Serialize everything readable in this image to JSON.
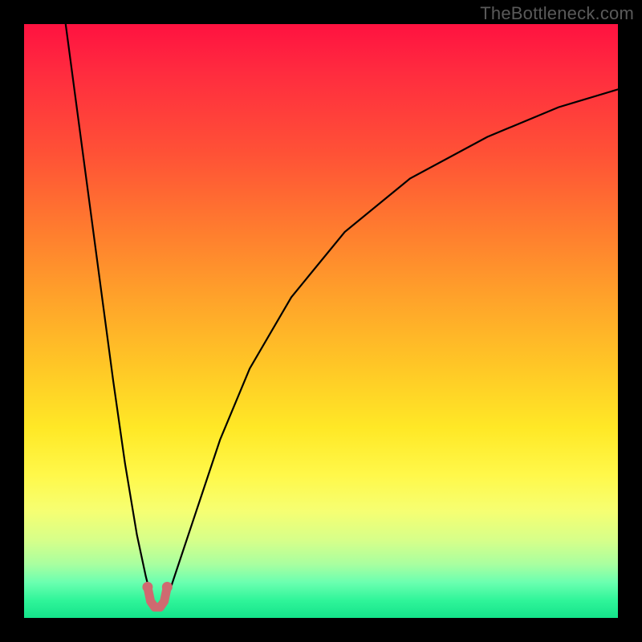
{
  "watermark": "TheBottleneck.com",
  "colors": {
    "frame": "#000000",
    "curve_stroke": "#000000",
    "marker_stroke": "#b95a60",
    "marker_fill": "#d97a80",
    "gradient_top": "#ff1240",
    "gradient_bottom": "#14e38a"
  },
  "chart_data": {
    "type": "line",
    "title": "",
    "xlabel": "",
    "ylabel": "",
    "xlim": [
      0,
      100
    ],
    "ylim": [
      0,
      100
    ],
    "grid": false,
    "notes": "Two thin black curves forming a V/funnel shape; both meet near x≈22 at the bottom. A short salmon U-shaped marker segment sits at the valley. Background is a vertical rainbow gradient (red→green).",
    "series": [
      {
        "name": "left_curve",
        "x": [
          7,
          9,
          11,
          13,
          15,
          17,
          19,
          20.5,
          21.5
        ],
        "y": [
          100,
          85,
          70,
          55,
          40,
          26,
          14,
          7,
          3
        ]
      },
      {
        "name": "right_curve",
        "x": [
          24,
          26,
          29,
          33,
          38,
          45,
          54,
          65,
          78,
          90,
          100
        ],
        "y": [
          3,
          9,
          18,
          30,
          42,
          54,
          65,
          74,
          81,
          86,
          89
        ]
      },
      {
        "name": "valley_marker_U",
        "x": [
          20.8,
          21.3,
          22.0,
          22.9,
          23.6,
          24.1
        ],
        "y": [
          5.2,
          2.8,
          1.8,
          1.8,
          2.8,
          5.2
        ]
      }
    ]
  }
}
